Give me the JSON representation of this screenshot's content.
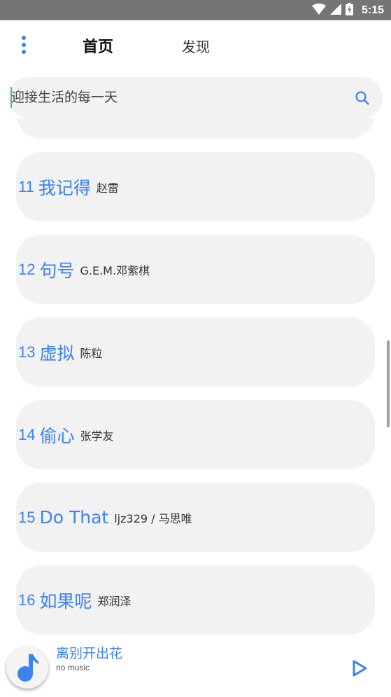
{
  "status_bar": {
    "time": "5:15"
  },
  "nav": {
    "tab_home": "首页",
    "tab_discover": "发现"
  },
  "search": {
    "placeholder": "迎接生活的每一天"
  },
  "songs": [
    {
      "num": "",
      "title": "",
      "artist": ""
    },
    {
      "num": "11",
      "title": "我记得",
      "artist": "赵雷"
    },
    {
      "num": "12",
      "title": "句号",
      "artist": "G.E.M.邓紫棋"
    },
    {
      "num": "13",
      "title": "虚拟",
      "artist": "陈粒"
    },
    {
      "num": "14",
      "title": "偷心",
      "artist": "张学友"
    },
    {
      "num": "15",
      "title": "Do That",
      "artist": "ljz329 / 马思唯"
    },
    {
      "num": "16",
      "title": "如果呢",
      "artist": "郑润泽"
    }
  ],
  "player": {
    "title": "离别开出花",
    "subtitle": "no music"
  },
  "colors": {
    "accent": "#3d82f0",
    "card_bg": "#f2f2f2",
    "status_bar": "#757575"
  },
  "icons": {
    "menu": "vertical-dots-icon",
    "search": "search-icon",
    "play": "play-icon",
    "album": "music-note-icon",
    "wifi": "wifi-icon",
    "signal": "signal-icon",
    "battery": "battery-icon"
  }
}
